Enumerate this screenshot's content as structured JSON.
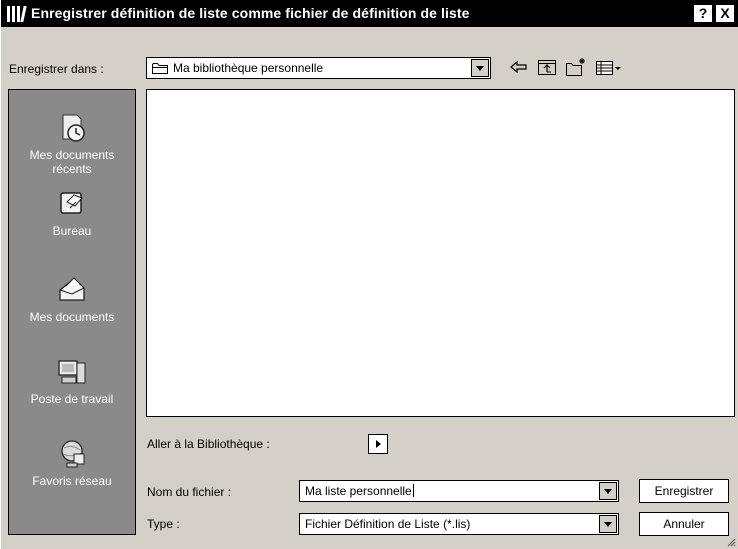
{
  "window": {
    "title": "Enregistrer définition de liste comme fichier de définition de liste",
    "help_glyph": "?",
    "close_glyph": "X"
  },
  "toolbar": {
    "save_in_label": "Enregistrer dans :",
    "save_in_value": "Ma bibliothèque personnelle",
    "icons": [
      "back-arrow-icon",
      "up-folder-icon",
      "new-folder-icon",
      "view-menu-icon"
    ]
  },
  "places": [
    {
      "label": "Mes documents récents",
      "icon": "recent-documents-icon"
    },
    {
      "label": "Bureau",
      "icon": "desktop-icon"
    },
    {
      "label": "Mes documents",
      "icon": "my-documents-icon"
    },
    {
      "label": "Poste de travail",
      "icon": "my-computer-icon"
    },
    {
      "label": "Favoris réseau",
      "icon": "network-places-icon"
    }
  ],
  "goto": {
    "label": "Aller à la Bibliothèque :"
  },
  "filename": {
    "label": "Nom du fichier :",
    "value": "Ma liste personnelle"
  },
  "type": {
    "label": "Type :",
    "value": "Fichier Définition de Liste (*.lis)"
  },
  "buttons": {
    "save": "Enregistrer",
    "cancel": "Annuler"
  }
}
